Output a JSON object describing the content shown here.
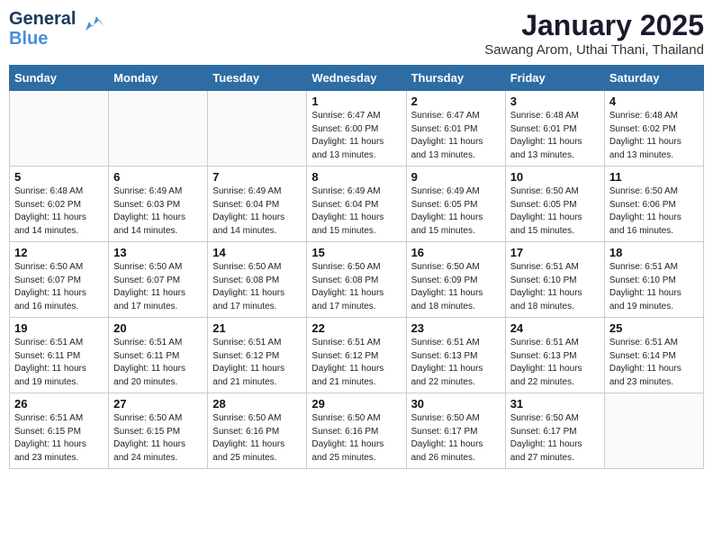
{
  "logo": {
    "line1": "General",
    "line2": "Blue"
  },
  "title": "January 2025",
  "location": "Sawang Arom, Uthai Thani, Thailand",
  "weekdays": [
    "Sunday",
    "Monday",
    "Tuesday",
    "Wednesday",
    "Thursday",
    "Friday",
    "Saturday"
  ],
  "weeks": [
    [
      {
        "num": "",
        "info": ""
      },
      {
        "num": "",
        "info": ""
      },
      {
        "num": "",
        "info": ""
      },
      {
        "num": "1",
        "info": "Sunrise: 6:47 AM\nSunset: 6:00 PM\nDaylight: 11 hours\nand 13 minutes."
      },
      {
        "num": "2",
        "info": "Sunrise: 6:47 AM\nSunset: 6:01 PM\nDaylight: 11 hours\nand 13 minutes."
      },
      {
        "num": "3",
        "info": "Sunrise: 6:48 AM\nSunset: 6:01 PM\nDaylight: 11 hours\nand 13 minutes."
      },
      {
        "num": "4",
        "info": "Sunrise: 6:48 AM\nSunset: 6:02 PM\nDaylight: 11 hours\nand 13 minutes."
      }
    ],
    [
      {
        "num": "5",
        "info": "Sunrise: 6:48 AM\nSunset: 6:02 PM\nDaylight: 11 hours\nand 14 minutes."
      },
      {
        "num": "6",
        "info": "Sunrise: 6:49 AM\nSunset: 6:03 PM\nDaylight: 11 hours\nand 14 minutes."
      },
      {
        "num": "7",
        "info": "Sunrise: 6:49 AM\nSunset: 6:04 PM\nDaylight: 11 hours\nand 14 minutes."
      },
      {
        "num": "8",
        "info": "Sunrise: 6:49 AM\nSunset: 6:04 PM\nDaylight: 11 hours\nand 15 minutes."
      },
      {
        "num": "9",
        "info": "Sunrise: 6:49 AM\nSunset: 6:05 PM\nDaylight: 11 hours\nand 15 minutes."
      },
      {
        "num": "10",
        "info": "Sunrise: 6:50 AM\nSunset: 6:05 PM\nDaylight: 11 hours\nand 15 minutes."
      },
      {
        "num": "11",
        "info": "Sunrise: 6:50 AM\nSunset: 6:06 PM\nDaylight: 11 hours\nand 16 minutes."
      }
    ],
    [
      {
        "num": "12",
        "info": "Sunrise: 6:50 AM\nSunset: 6:07 PM\nDaylight: 11 hours\nand 16 minutes."
      },
      {
        "num": "13",
        "info": "Sunrise: 6:50 AM\nSunset: 6:07 PM\nDaylight: 11 hours\nand 17 minutes."
      },
      {
        "num": "14",
        "info": "Sunrise: 6:50 AM\nSunset: 6:08 PM\nDaylight: 11 hours\nand 17 minutes."
      },
      {
        "num": "15",
        "info": "Sunrise: 6:50 AM\nSunset: 6:08 PM\nDaylight: 11 hours\nand 17 minutes."
      },
      {
        "num": "16",
        "info": "Sunrise: 6:50 AM\nSunset: 6:09 PM\nDaylight: 11 hours\nand 18 minutes."
      },
      {
        "num": "17",
        "info": "Sunrise: 6:51 AM\nSunset: 6:10 PM\nDaylight: 11 hours\nand 18 minutes."
      },
      {
        "num": "18",
        "info": "Sunrise: 6:51 AM\nSunset: 6:10 PM\nDaylight: 11 hours\nand 19 minutes."
      }
    ],
    [
      {
        "num": "19",
        "info": "Sunrise: 6:51 AM\nSunset: 6:11 PM\nDaylight: 11 hours\nand 19 minutes."
      },
      {
        "num": "20",
        "info": "Sunrise: 6:51 AM\nSunset: 6:11 PM\nDaylight: 11 hours\nand 20 minutes."
      },
      {
        "num": "21",
        "info": "Sunrise: 6:51 AM\nSunset: 6:12 PM\nDaylight: 11 hours\nand 21 minutes."
      },
      {
        "num": "22",
        "info": "Sunrise: 6:51 AM\nSunset: 6:12 PM\nDaylight: 11 hours\nand 21 minutes."
      },
      {
        "num": "23",
        "info": "Sunrise: 6:51 AM\nSunset: 6:13 PM\nDaylight: 11 hours\nand 22 minutes."
      },
      {
        "num": "24",
        "info": "Sunrise: 6:51 AM\nSunset: 6:13 PM\nDaylight: 11 hours\nand 22 minutes."
      },
      {
        "num": "25",
        "info": "Sunrise: 6:51 AM\nSunset: 6:14 PM\nDaylight: 11 hours\nand 23 minutes."
      }
    ],
    [
      {
        "num": "26",
        "info": "Sunrise: 6:51 AM\nSunset: 6:15 PM\nDaylight: 11 hours\nand 23 minutes."
      },
      {
        "num": "27",
        "info": "Sunrise: 6:50 AM\nSunset: 6:15 PM\nDaylight: 11 hours\nand 24 minutes."
      },
      {
        "num": "28",
        "info": "Sunrise: 6:50 AM\nSunset: 6:16 PM\nDaylight: 11 hours\nand 25 minutes."
      },
      {
        "num": "29",
        "info": "Sunrise: 6:50 AM\nSunset: 6:16 PM\nDaylight: 11 hours\nand 25 minutes."
      },
      {
        "num": "30",
        "info": "Sunrise: 6:50 AM\nSunset: 6:17 PM\nDaylight: 11 hours\nand 26 minutes."
      },
      {
        "num": "31",
        "info": "Sunrise: 6:50 AM\nSunset: 6:17 PM\nDaylight: 11 hours\nand 27 minutes."
      },
      {
        "num": "",
        "info": ""
      }
    ]
  ]
}
